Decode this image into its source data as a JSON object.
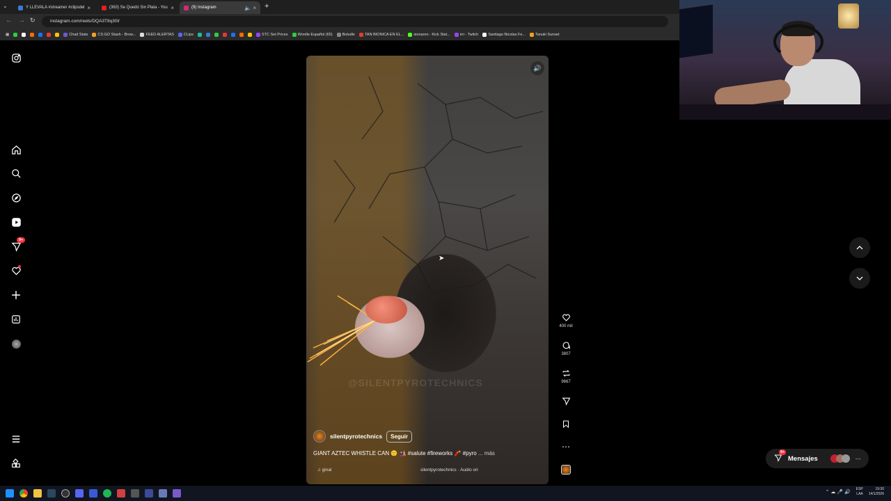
{
  "browser": {
    "tabs": [
      {
        "label": "Y LLEVALA #streamer #clipsdel",
        "active": false,
        "fav": "#3a7bd5"
      },
      {
        "label": "(363) Se Quedó Sin Plata - You",
        "active": false,
        "fav": "#e02020"
      },
      {
        "label": "(9) Instagram",
        "active": true,
        "fav": "#d62976"
      }
    ],
    "url": "instagram.com/reels/DQA3T8q30l/",
    "bookmarks": [
      "Chad Stats",
      "CS:GO Stash - Brow...",
      "FEED ALERTAS",
      "CLips",
      "STC Set Prices",
      "Wordle Español (65)",
      "Boludle",
      "TAN BIONICA EN EL...",
      "sionaron - Kick Stat...",
      "irri - Twitch",
      "Santiago Nicolas Fe...",
      "Tanuki Sunset"
    ]
  },
  "sidebar": {
    "notification_badge": "9+"
  },
  "reel": {
    "username": "silentpyrotechnics",
    "follow_label": "Seguir",
    "caption": "GIANT AZTEC WHISTLE CAN 🙂 🎎 #salute #fireworks 🧨 #pyro",
    "more_label": "... más",
    "audio_left": "ginal",
    "audio_right": "silentpyrotechnics · Audio ori",
    "watermark": "@SILENTPYROTECHNICS",
    "likes": "400 mil",
    "comments": "3807",
    "reposts": "9667"
  },
  "messages": {
    "label": "Mensajes",
    "badge": "9+"
  },
  "taskbar": {
    "lang": "ESP\nLAA",
    "time": "19:30",
    "date": "14/1/2026"
  },
  "colors": {
    "accent": "#ff3040",
    "bg": "#000000"
  }
}
